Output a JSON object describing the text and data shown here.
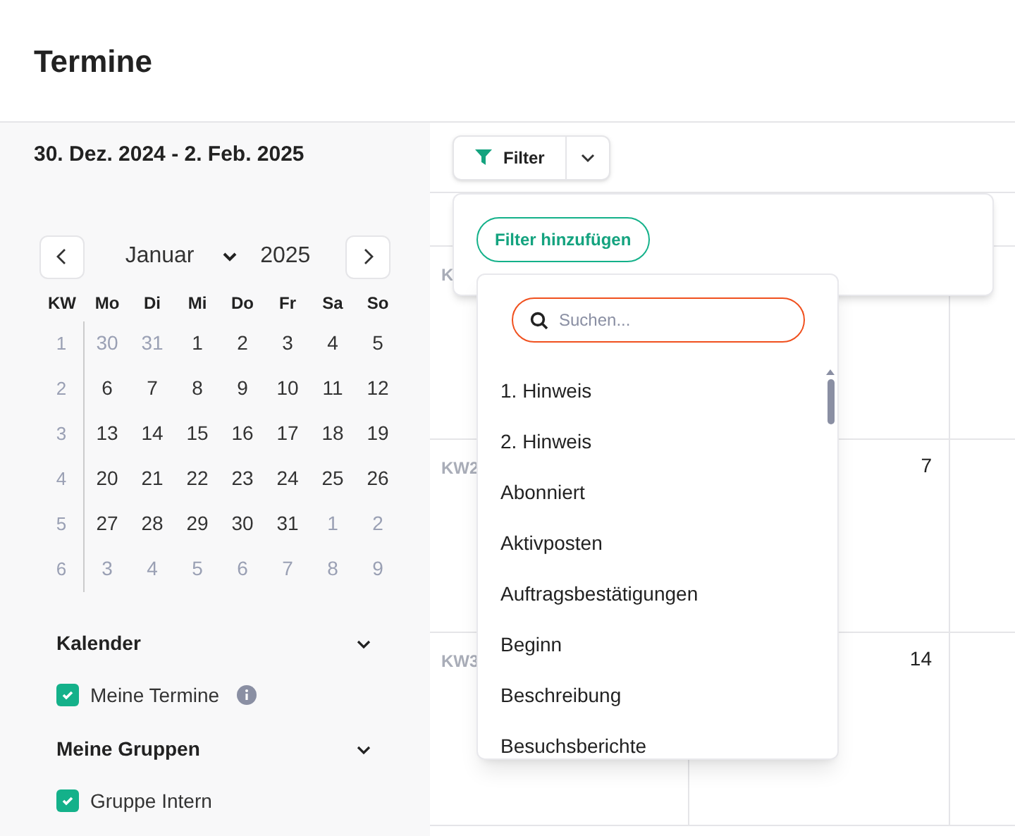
{
  "page": {
    "title": "Termine"
  },
  "sidebar": {
    "date_range": "30. Dez. 2024 - 2. Feb. 2025",
    "mini_calendar": {
      "month": "Januar",
      "year": "2025",
      "header": [
        "KW",
        "Mo",
        "Di",
        "Mi",
        "Do",
        "Fr",
        "Sa",
        "So"
      ],
      "weeks": [
        {
          "week": "1",
          "days": [
            {
              "day": "30",
              "outside": true
            },
            {
              "day": "31",
              "outside": true
            },
            {
              "day": "1",
              "outside": false
            },
            {
              "day": "2",
              "outside": false
            },
            {
              "day": "3",
              "outside": false
            },
            {
              "day": "4",
              "outside": false
            },
            {
              "day": "5",
              "outside": false
            }
          ]
        },
        {
          "week": "2",
          "days": [
            {
              "day": "6",
              "outside": false
            },
            {
              "day": "7",
              "outside": false
            },
            {
              "day": "8",
              "outside": false
            },
            {
              "day": "9",
              "outside": false
            },
            {
              "day": "10",
              "outside": false
            },
            {
              "day": "11",
              "outside": false
            },
            {
              "day": "12",
              "outside": false
            }
          ]
        },
        {
          "week": "3",
          "days": [
            {
              "day": "13",
              "outside": false
            },
            {
              "day": "14",
              "outside": false
            },
            {
              "day": "15",
              "outside": false
            },
            {
              "day": "16",
              "outside": false
            },
            {
              "day": "17",
              "outside": false
            },
            {
              "day": "18",
              "outside": false
            },
            {
              "day": "19",
              "outside": false
            }
          ]
        },
        {
          "week": "4",
          "days": [
            {
              "day": "20",
              "outside": false
            },
            {
              "day": "21",
              "outside": false
            },
            {
              "day": "22",
              "outside": false
            },
            {
              "day": "23",
              "outside": false
            },
            {
              "day": "24",
              "outside": false
            },
            {
              "day": "25",
              "outside": false
            },
            {
              "day": "26",
              "outside": false
            }
          ]
        },
        {
          "week": "5",
          "days": [
            {
              "day": "27",
              "outside": false
            },
            {
              "day": "28",
              "outside": false
            },
            {
              "day": "29",
              "outside": false
            },
            {
              "day": "30",
              "outside": false
            },
            {
              "day": "31",
              "outside": false
            },
            {
              "day": "1",
              "outside": true
            },
            {
              "day": "2",
              "outside": true
            }
          ]
        },
        {
          "week": "6",
          "days": [
            {
              "day": "3",
              "outside": true
            },
            {
              "day": "4",
              "outside": true
            },
            {
              "day": "5",
              "outside": true
            },
            {
              "day": "6",
              "outside": true
            },
            {
              "day": "7",
              "outside": true
            },
            {
              "day": "8",
              "outside": true
            },
            {
              "day": "9",
              "outside": true
            }
          ]
        }
      ]
    },
    "sections": [
      {
        "title": "Kalender",
        "expanded": true,
        "items": [
          {
            "label": "Meine Termine",
            "checked": true,
            "info": true
          }
        ]
      },
      {
        "title": "Meine Gruppen",
        "expanded": true,
        "items": [
          {
            "label": "Gruppe Intern",
            "checked": true,
            "info": false
          }
        ]
      }
    ]
  },
  "toolbar": {
    "filter_button": "Filter"
  },
  "calendar": {
    "rows": [
      {
        "week": "K"
      },
      {
        "week": "KW2",
        "column_2_date": "7"
      },
      {
        "week": "KW3",
        "column_2_date": "14"
      }
    ]
  },
  "filter_panel": {
    "add_button": "Filter hinzufügen",
    "search": {
      "placeholder": "Suchen..."
    },
    "options": [
      "1. Hinweis",
      "2. Hinweis",
      "Abonniert",
      "Aktivposten",
      "Auftragsbestätigungen",
      "Beginn",
      "Beschreibung",
      "Besuchsberichte"
    ]
  }
}
